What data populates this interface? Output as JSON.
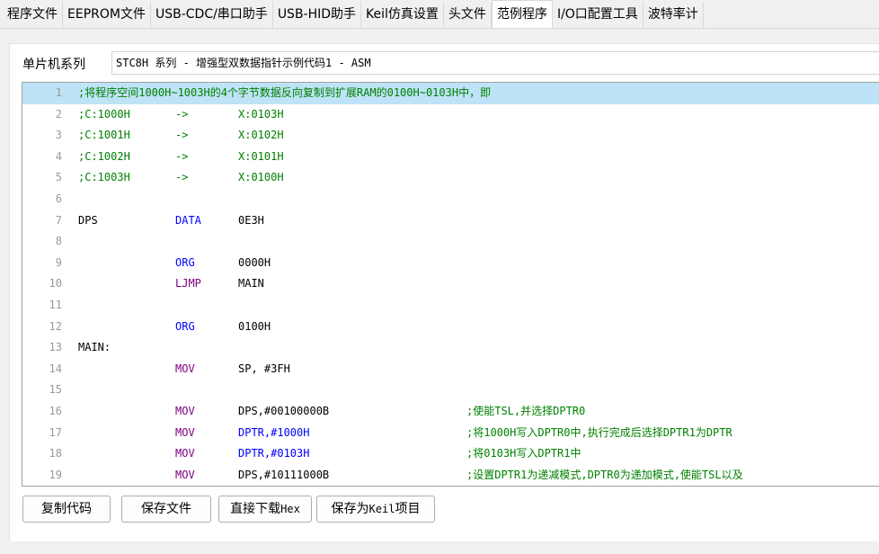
{
  "tabs": [
    {
      "label": "程序文件",
      "active": false
    },
    {
      "label": "EEPROM文件",
      "active": false
    },
    {
      "label": "USB-CDC/串口助手",
      "active": false
    },
    {
      "label": "USB-HID助手",
      "active": false
    },
    {
      "label": "Keil仿真设置",
      "active": false
    },
    {
      "label": "头文件",
      "active": false
    },
    {
      "label": "范例程序",
      "active": true
    },
    {
      "label": "I/O口配置工具",
      "active": false
    },
    {
      "label": "波特率计",
      "active": false
    }
  ],
  "series": {
    "label": "单片机系列",
    "selected": "STC8H 系列 - 增强型双数据指针示例代码1 - ASM"
  },
  "code": {
    "lines": [
      {
        "n": "1",
        "full": ";将程序空间1000H~1003H的4个字节数据反向复制到扩展RAM的0100H~0103H中，即",
        "hl": true
      },
      {
        "n": "2",
        "label": ";C:1000H",
        "label_color": "green",
        "op": "->",
        "op_color": "green",
        "arg": "X:0103H",
        "arg_color": "green"
      },
      {
        "n": "3",
        "label": ";C:1001H",
        "label_color": "green",
        "op": "->",
        "op_color": "green",
        "arg": "X:0102H",
        "arg_color": "green"
      },
      {
        "n": "4",
        "label": ";C:1002H",
        "label_color": "green",
        "op": "->",
        "op_color": "green",
        "arg": "X:0101H",
        "arg_color": "green"
      },
      {
        "n": "5",
        "label": ";C:1003H",
        "label_color": "green",
        "op": "->",
        "op_color": "green",
        "arg": "X:0100H",
        "arg_color": "green"
      },
      {
        "n": "6"
      },
      {
        "n": "7",
        "label": "DPS",
        "op": "DATA",
        "op_color": "blue",
        "arg": "0E3H"
      },
      {
        "n": "8"
      },
      {
        "n": "9",
        "op": "ORG",
        "op_color": "blue",
        "arg": "0000H"
      },
      {
        "n": "10",
        "op": "LJMP",
        "op_color": "purple",
        "arg": "MAIN"
      },
      {
        "n": "11"
      },
      {
        "n": "12",
        "op": "ORG",
        "op_color": "blue",
        "arg": "0100H"
      },
      {
        "n": "13",
        "label": "MAIN:"
      },
      {
        "n": "14",
        "op": "MOV",
        "op_color": "purple",
        "arg": "SP, #3FH"
      },
      {
        "n": "15"
      },
      {
        "n": "16",
        "op": "MOV",
        "op_color": "purple",
        "arg": "DPS,#00100000B",
        "comment": ";使能TSL,并选择DPTR0"
      },
      {
        "n": "17",
        "op": "MOV",
        "op_color": "purple",
        "arg": "DPTR,#1000H",
        "arg_color": "blue",
        "comment": ";将1000H写入DPTR0中,执行完成后选择DPTR1为DPTR"
      },
      {
        "n": "18",
        "op": "MOV",
        "op_color": "purple",
        "arg": "DPTR,#0103H",
        "arg_color": "blue",
        "comment": ";将0103H写入DPTR1中"
      },
      {
        "n": "19",
        "op": "MOV",
        "op_color": "purple",
        "arg": "DPS,#10111000B",
        "comment": ";设置DPTR1为递减模式,DPTR0为递加模式,使能TSL以及"
      }
    ]
  },
  "buttons": {
    "copy": "复制代码",
    "save": "保存文件",
    "download_prefix": "直接下载",
    "download_suffix": "Hex",
    "keil_prefix": "保存为",
    "keil_mid": "Keil",
    "keil_suffix": "项目"
  },
  "colors": {
    "highlight": "#bfe3f6",
    "comment": "#008000",
    "keyword_blue": "#0000ff",
    "keyword_purple": "#800080",
    "line_number": "#9a9a9a"
  }
}
